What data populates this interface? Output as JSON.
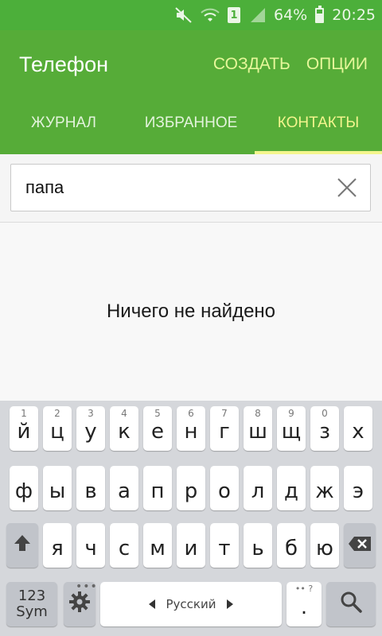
{
  "status_bar": {
    "battery": "64%",
    "time": "20:25",
    "sim": "1"
  },
  "app_bar": {
    "title": "Телефон",
    "create": "СОЗДАТЬ",
    "options": "ОПЦИИ"
  },
  "tabs": [
    {
      "label": "ЖУРНАЛ"
    },
    {
      "label": "ИЗБРАННОЕ"
    },
    {
      "label": "КОНТАКТЫ"
    }
  ],
  "search": {
    "value": "папа"
  },
  "empty": {
    "message": "Ничего не найдено"
  },
  "keyboard": {
    "row1": [
      {
        "k": "й",
        "h": "1"
      },
      {
        "k": "ц",
        "h": "2"
      },
      {
        "k": "у",
        "h": "3"
      },
      {
        "k": "к",
        "h": "4"
      },
      {
        "k": "е",
        "h": "5"
      },
      {
        "k": "н",
        "h": "6"
      },
      {
        "k": "г",
        "h": "7"
      },
      {
        "k": "ш",
        "h": "8"
      },
      {
        "k": "щ",
        "h": "9"
      },
      {
        "k": "з",
        "h": "0"
      },
      {
        "k": "х",
        "h": ""
      }
    ],
    "row2": [
      "ф",
      "ы",
      "в",
      "а",
      "п",
      "р",
      "о",
      "л",
      "д",
      "ж",
      "э"
    ],
    "row3": [
      "я",
      "ч",
      "с",
      "м",
      "и",
      "т",
      "ь",
      "б",
      "ю"
    ],
    "sym_line1": "123",
    "sym_line2": "Sym",
    "space_label": "Русский",
    "period": "."
  }
}
